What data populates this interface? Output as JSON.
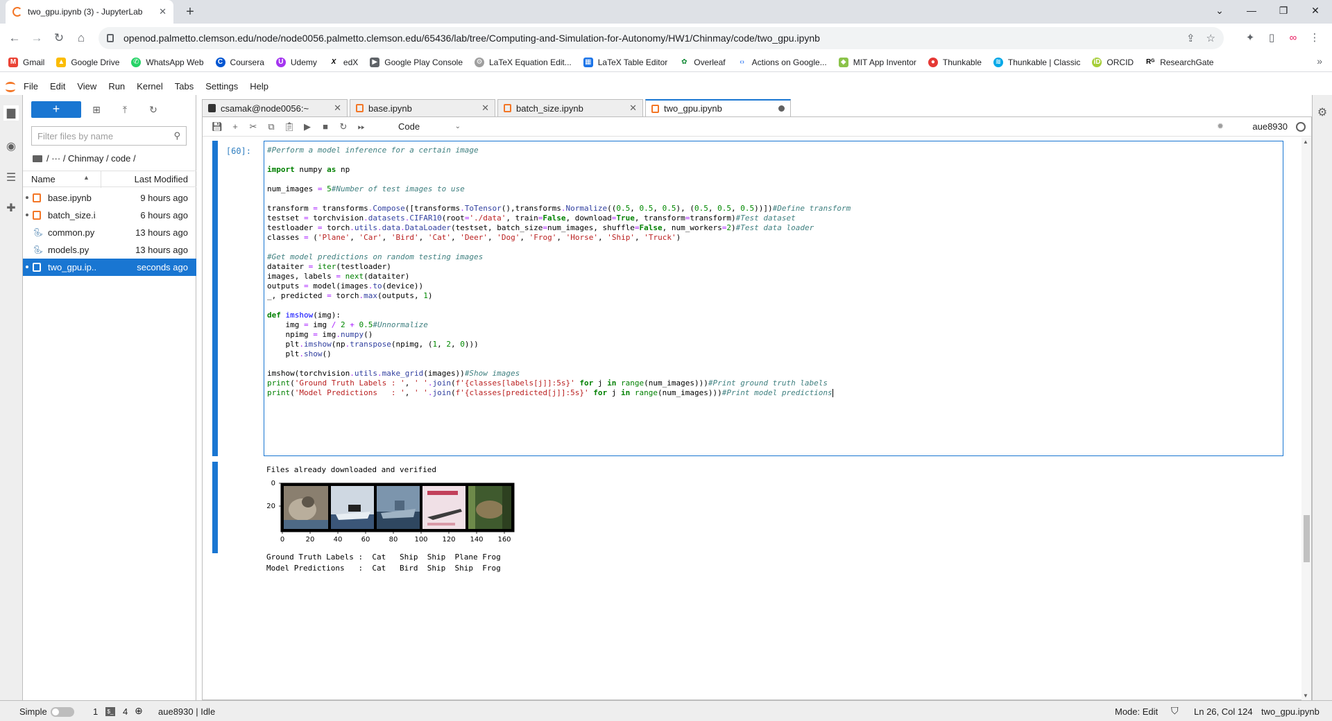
{
  "browser": {
    "tab_title": "two_gpu.ipynb (3) - JupyterLab",
    "url": "openod.palmetto.clemson.edu/node/node0056.palmetto.clemson.edu/65436/lab/tree/Computing-and-Simulation-for-Autonomy/HW1/Chinmay/code/two_gpu.ipynb",
    "bookmarks": [
      "Gmail",
      "Google Drive",
      "WhatsApp Web",
      "Coursera",
      "Udemy",
      "edX",
      "Google Play Console",
      "LaTeX Equation Edit...",
      "LaTeX Table Editor",
      "Overleaf",
      "Actions on Google...",
      "MIT App Inventor",
      "Thunkable",
      "Thunkable | Classic",
      "ORCID",
      "ResearchGate"
    ]
  },
  "menu": [
    "File",
    "Edit",
    "View",
    "Run",
    "Kernel",
    "Tabs",
    "Settings",
    "Help"
  ],
  "filebrowser": {
    "filter_placeholder": "Filter files by name",
    "breadcrumb": "/   ···   / Chinmay / code /",
    "col_name": "Name",
    "col_modified": "Last Modified",
    "files": [
      {
        "name": "base.ipynb",
        "modified": "9 hours ago"
      },
      {
        "name": "batch_size.i...",
        "modified": "6 hours ago"
      },
      {
        "name": "common.py",
        "modified": "13 hours ago"
      },
      {
        "name": "models.py",
        "modified": "13 hours ago"
      },
      {
        "name": "two_gpu.ip...",
        "modified": "seconds ago"
      }
    ]
  },
  "tabs": [
    {
      "label": "csamak@node0056:~"
    },
    {
      "label": "base.ipynb"
    },
    {
      "label": "batch_size.ipynb"
    },
    {
      "label": "two_gpu.ipynb"
    }
  ],
  "toolbar": {
    "cell_type": "Code",
    "kernel": "aue8930"
  },
  "cell": {
    "prompt": "[60]:",
    "output_line1": "Files already downloaded and verified",
    "output_gt": "Ground Truth Labels :  Cat   Ship  Ship  Plane Frog",
    "output_pred": "Model Predictions   :  Cat   Bird  Ship  Ship  Frog",
    "plot_y_ticks": [
      "0",
      "20"
    ],
    "plot_x_ticks": [
      "0",
      "20",
      "40",
      "60",
      "80",
      "100",
      "120",
      "140",
      "160"
    ]
  },
  "status": {
    "mode_label": "Simple",
    "num1": "1",
    "num2": "4",
    "kernel_status": "aue8930 | Idle",
    "mode": "Mode: Edit",
    "position": "Ln 26, Col 124",
    "file": "two_gpu.ipynb"
  },
  "colors": {
    "accent": "#1976d2",
    "jupyter_orange": "#f37626"
  }
}
